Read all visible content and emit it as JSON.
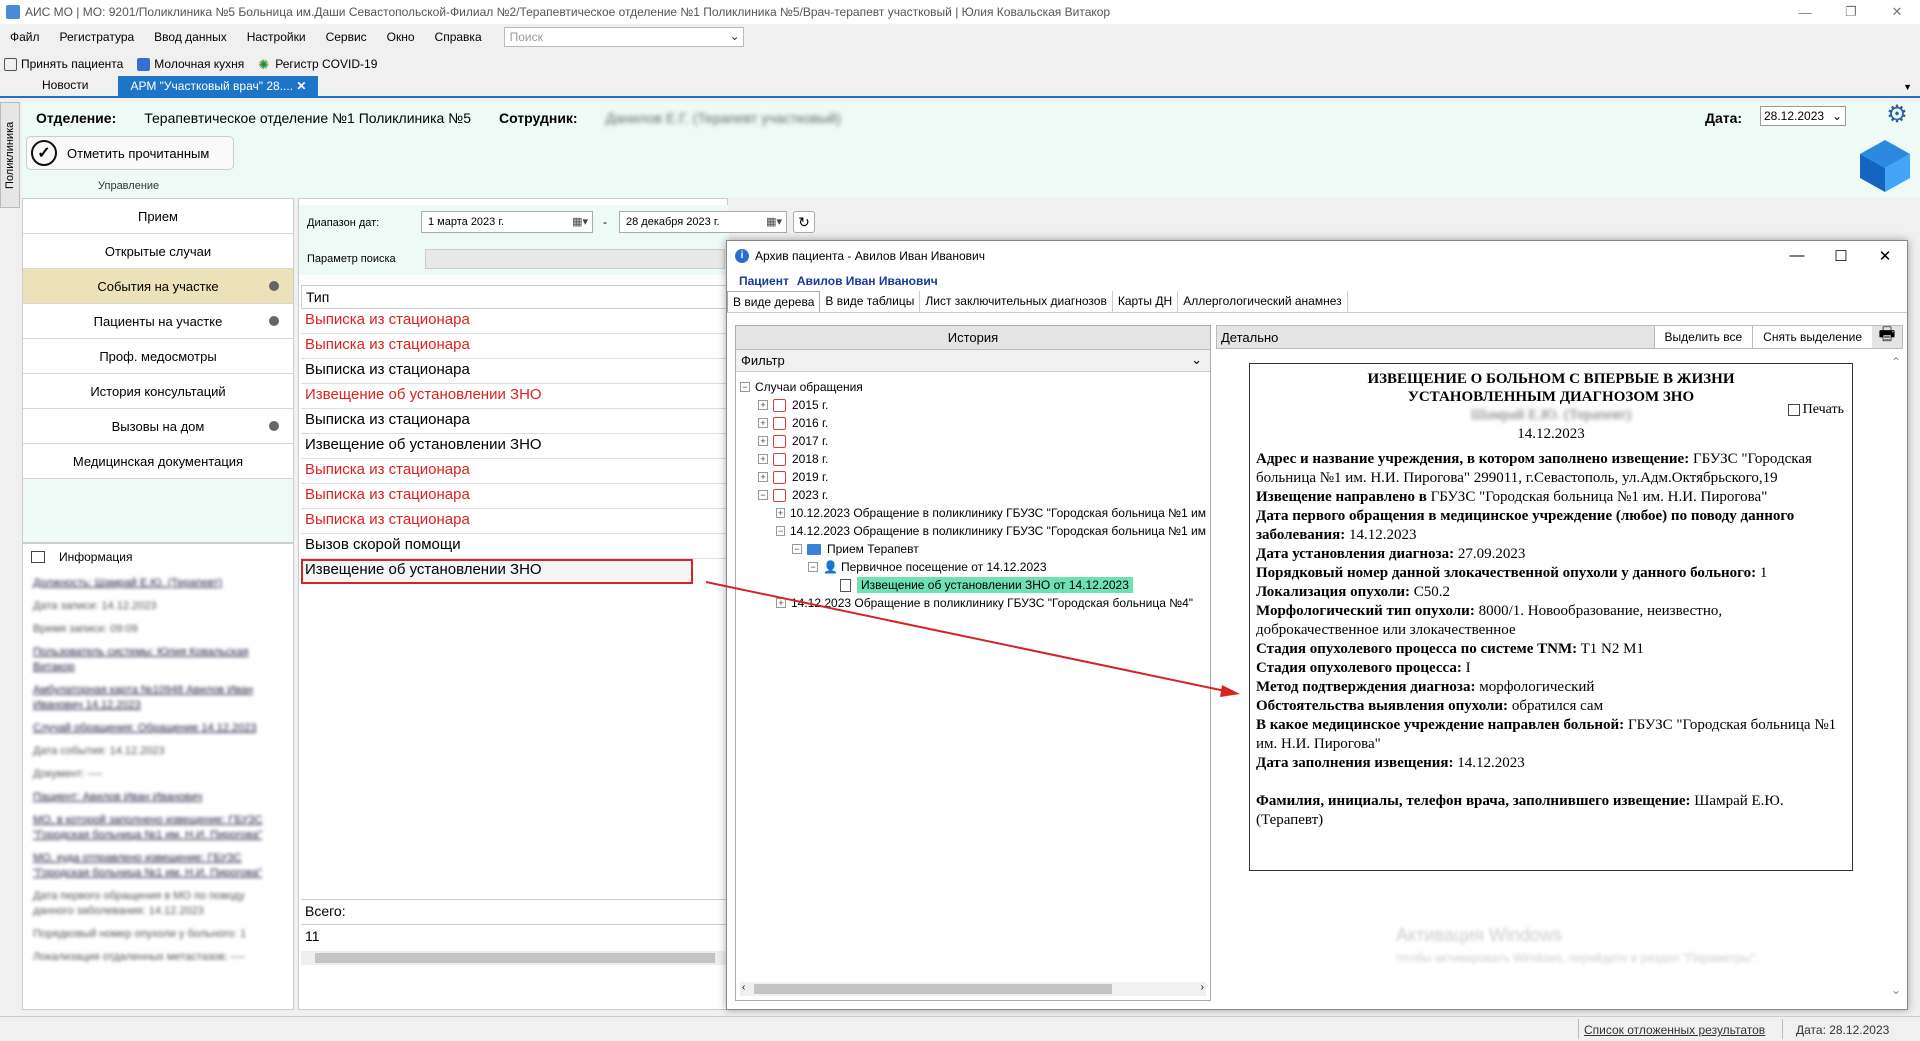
{
  "titlebar": {
    "title": "АИС МО | МО: 9201/Поликлиника №5 Больница им.Даши Севастопольской-Филиал №2/Терапевтическое отделение №1 Поликлиника №5/Врач-терапевт участковый | Юлия Ковальская Витакор"
  },
  "menu": {
    "items": [
      "Файл",
      "Регистратура",
      "Ввод данных",
      "Настройки",
      "Сервис",
      "Окно",
      "Справка"
    ],
    "search_placeholder": "Поиск"
  },
  "toolbar": {
    "items": [
      "Принять пациента",
      "Молочная кухня",
      "Регистр COVID-19"
    ]
  },
  "tabs": {
    "news": "Новости",
    "active": "АРМ \"Участковый врач\" 28....",
    "close": "✕"
  },
  "sidetab": {
    "label": "Поликлиника"
  },
  "header": {
    "dept_label": "Отделение:",
    "dept_value": "Терапевтическое отделение №1 Поликлиника №5",
    "employee_label": "Сотрудник:",
    "employee_value": "Данилов Е.Г. (Терапевт участковый)",
    "date_label": "Дата:",
    "date_value": "28.12.2023",
    "mark_read": "Отметить прочитанным",
    "group_label": "Управление"
  },
  "nav": {
    "items": [
      {
        "label": "Прием",
        "dot": false,
        "selected": false
      },
      {
        "label": "Открытые случаи",
        "dot": false,
        "selected": false
      },
      {
        "label": "События на участке",
        "dot": true,
        "selected": true
      },
      {
        "label": "Пациенты на участке",
        "dot": true,
        "selected": false
      },
      {
        "label": "Проф. медосмотры",
        "dot": false,
        "selected": false
      },
      {
        "label": "История консультаций",
        "dot": false,
        "selected": false
      },
      {
        "label": "Вызовы на дом",
        "dot": true,
        "selected": false
      },
      {
        "label": "Медицинская документация",
        "dot": false,
        "selected": false
      }
    ]
  },
  "info": {
    "title": "Информация",
    "lines": [
      {
        "text": "Должность: Шамрай Е.Ю. (Терапевт)",
        "link": true
      },
      {
        "text": "Дата записи: 14.12.2023",
        "link": false
      },
      {
        "text": "Время записи: 09:09",
        "link": false
      },
      {
        "text": "Пользователь системы: Юлия Ковальская Витакор",
        "link": true
      },
      {
        "text": "Амбулаторная карта №10948 Авилов Иван Иванович 14.12.2023",
        "link": true
      },
      {
        "text": "Случай обращения: Обращение 14.12.2023",
        "link": true
      },
      {
        "text": "Дата события: 14.12.2023",
        "link": false
      },
      {
        "text": "Документ: ----",
        "link": false
      },
      {
        "text": "Пациент: Авилов Иван Иванович",
        "link": true
      },
      {
        "text": "МО, в которой заполнено извещение: ГБУЗС \"Городская больница №1 им. Н.И. Пирогова\"",
        "link": true
      },
      {
        "text": "МО, куда отправлено извещение: ГБУЗС \"Городская больница №1 им. Н.И. Пирогова\"",
        "link": true
      },
      {
        "text": "Дата первого обращения в МО по поводу данного заболевания: 14.12.2023",
        "link": false
      },
      {
        "text": "Порядковый номер опухоли у больного: 1",
        "link": false
      },
      {
        "text": "Локализация отдаленных метастазов: ----",
        "link": false
      }
    ]
  },
  "center": {
    "date_range_label": "Диапазон дат:",
    "date_from": "1   марта   2023 г.",
    "date_to": "28  декабря  2023 г.",
    "dash": "-",
    "search_param_label": "Параметр поиска",
    "grid_header": "Тип",
    "rows": [
      {
        "text": "Выписка из стационара",
        "red": true
      },
      {
        "text": "Выписка из стационара",
        "red": true
      },
      {
        "text": "Выписка из стационара",
        "red": false
      },
      {
        "text": "Извещение об установлении ЗНО",
        "red": true
      },
      {
        "text": "Выписка из стационара",
        "red": false
      },
      {
        "text": "Извещение об установлении ЗНО",
        "red": false
      },
      {
        "text": "Выписка из стационара",
        "red": true
      },
      {
        "text": "Выписка из стационара",
        "red": true
      },
      {
        "text": "Выписка из стационара",
        "red": true
      },
      {
        "text": "Вызов скорой помощи",
        "red": false
      },
      {
        "text": "Извещение об установлении ЗНО",
        "red": false,
        "highlight": true
      }
    ],
    "total_label": "Всего:",
    "total_value": "11"
  },
  "dialog": {
    "title": "Архив пациента - Авилов Иван Иванович",
    "patient_label": "Пациент",
    "patient_name": "Авилов Иван Иванович",
    "tabs": [
      "В виде дерева",
      "В виде таблицы",
      "Лист заключительных диагнозов",
      "Карты ДН",
      "Аллергологический анамнез"
    ],
    "history_label": "История",
    "filter_label": "Фильтр",
    "tree": {
      "root": "Случаи обращения",
      "years": [
        "2015 г.",
        "2016 г.",
        "2017 г.",
        "2018 г.",
        "2019 г.",
        "2023 г."
      ],
      "case1": "10.12.2023 Обращение в поликлинику ГБУЗС \"Городская больница №1 им",
      "case2": "14.12.2023 Обращение в поликлинику ГБУЗС \"Городская больница №1 им",
      "reception": "Прием Терапевт",
      "visit": "Первичное посещение от 14.12.2023",
      "notice": "Извещение об установлении ЗНО от 14.12.2023",
      "case3": "14.12.2023 Обращение в поликлинику ГБУЗС \"Городская больница №4\""
    },
    "detail_label": "Детально",
    "select_all": "Выделить все",
    "deselect": "Снять выделение",
    "print_label": "Печать",
    "doc": {
      "title": "ИЗВЕЩЕНИЕ О БОЛЬНОМ С ВПЕРВЫЕ В ЖИЗНИ УСТАНОВЛЕННЫМ ДИАГНОЗОМ ЗНО",
      "author": "Шамрай Е.Ю. (Терапевт)",
      "date": "14.12.2023",
      "fields": [
        {
          "label": "Адрес и название учреждения, в котором заполнено извещение:",
          "value": " ГБУЗС \"Городская больница №1 им. Н.И. Пирогова\" 299011, г.Севастополь, ул.Адм.Октябрьского,19"
        },
        {
          "label": "Извещение направлено в",
          "value": " ГБУЗС \"Городская больница №1 им. Н.И. Пирогова\""
        },
        {
          "label": "Дата первого обращения в медицинское учреждение (любое) по поводу данного заболевания:",
          "value": " 14.12.2023"
        },
        {
          "label": "Дата установления диагноза:",
          "value": " 27.09.2023"
        },
        {
          "label": "Порядковый номер данной злокачественной опухоли у данного больного:",
          "value": " 1"
        },
        {
          "label": "Локализация опухоли:",
          "value": " C50.2"
        },
        {
          "label": "Морфологический тип опухоли:",
          "value": " 8000/1. Новообразование, неизвестно, доброкачественное или злокачественное"
        },
        {
          "label": "Стадия опухолевого процесса по системе TNM:",
          "value": " T1 N2 M1"
        },
        {
          "label": "Стадия опухолевого процесса:",
          "value": " I"
        },
        {
          "label": "Метод подтверждения диагноза:",
          "value": " морфологический"
        },
        {
          "label": "Обстоятельства выявления опухоли:",
          "value": " обратился сам"
        },
        {
          "label": "В какое медицинское учреждение направлен больной:",
          "value": " ГБУЗС \"Городская больница №1 им. Н.И. Пирогова\""
        },
        {
          "label": "Дата заполнения извещения:",
          "value": " 14.12.2023"
        }
      ],
      "footer_label": "Фамилия, инициалы, телефон врача, заполнившего извещение:",
      "footer_value": " Шамрай Е.Ю. (Терапевт)"
    },
    "watermark1": "Активация Windows",
    "watermark2": "Чтобы активировать Windows, перейдите в раздел \"Параметры\"."
  },
  "status": {
    "link": "Список отложенных результатов",
    "date": "Дата: 28.12.2023"
  },
  "colors": {
    "accent": "#1e74c6",
    "header_bg": "#eefaf6",
    "selected_nav": "#ece2b9",
    "red_text": "#e02020",
    "tree_selected": "#6ee0b4",
    "annotation_red": "#d42424"
  }
}
